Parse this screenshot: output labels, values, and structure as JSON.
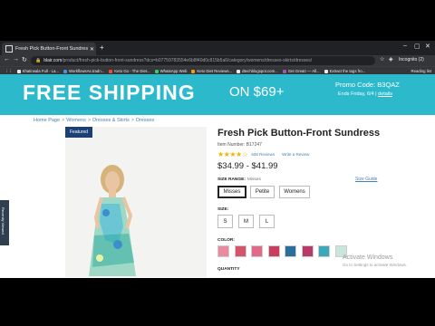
{
  "browser": {
    "tab_title": "Fresh Pick Button-Front Sundress",
    "url_domain": "blair.com",
    "url_path": "/product/fresh-pick-button-front-sundress?dcs=b07759783554e6b8f40d0c815b5a6/category/womens/dresses-skirts/dresses/",
    "profile_label": "Incognito (2)",
    "bookmarks": [
      {
        "label": "Khatirwala Full - La...",
        "color": "#e8eaed"
      },
      {
        "label": "WorkflowsAs.tradn...",
        "color": "#4a90e2"
      },
      {
        "label": "Keto Go - The Diet...",
        "color": "#e84c3d"
      },
      {
        "label": "WhatsApp Web",
        "color": "#25d366"
      },
      {
        "label": "Keto Diet Reviews...",
        "color": "#f39c12"
      },
      {
        "label": "dtechblogspot.com...",
        "color": "#e8eaed"
      },
      {
        "label": "Get Great! — All...",
        "color": "#9b59b6"
      },
      {
        "label": "Extract the tags fro...",
        "color": "#e8eaed"
      }
    ],
    "reading_list": "Reading list"
  },
  "banner": {
    "headline": "FREE SHIPPING",
    "threshold": "ON $69+",
    "promo": "Promo Code: B3QAZ",
    "ends": "Ends Friday, 6/4 |",
    "details": "details",
    "bg_color": "#2bb9cb"
  },
  "breadcrumb": [
    "Home Page",
    "Womens",
    "Dresses & Skirts",
    "Dresses"
  ],
  "product": {
    "badge": "Featured",
    "title": "Fresh Pick Button-Front Sundress",
    "item_number": "Item Number: B17247",
    "stars": "★★★★☆",
    "reviews": "608 Reviews",
    "write_review": "Write a Review",
    "price": "$34.99 - $41.99",
    "size_range_label": "SIZE RANGE:",
    "size_range_value": "Misses",
    "size_guide": "Size Guide",
    "size_ranges": [
      "Misses",
      "Petite",
      "Womens"
    ],
    "size_label": "SIZE:",
    "sizes": [
      "S",
      "M",
      "L"
    ],
    "color_label": "COLOR:",
    "colors": [
      "#e98aa0",
      "#d4556a",
      "#e06a88",
      "#c93d5e",
      "#2a6e9c",
      "#b63a6a",
      "#3da8b8",
      "#c8e6dc"
    ],
    "quantity_label": "QUANTITY"
  },
  "side_tab": "Recently Viewed",
  "watermark": {
    "title": "Activate Windows",
    "sub": "Go to Settings to activate Windows."
  }
}
